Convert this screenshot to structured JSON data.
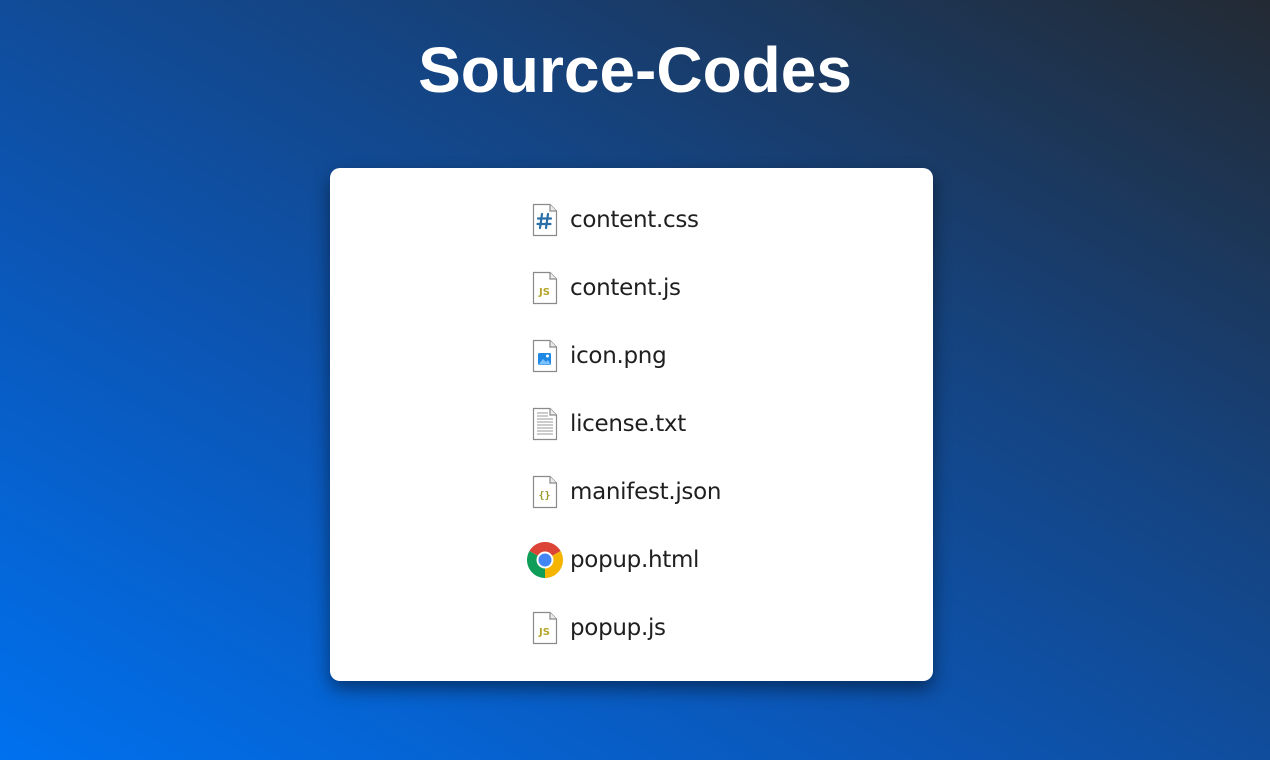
{
  "page": {
    "title": "Source-Codes"
  },
  "files": [
    {
      "name": "content.css",
      "icon": "css-file-icon"
    },
    {
      "name": "content.js",
      "icon": "js-file-icon"
    },
    {
      "name": "icon.png",
      "icon": "image-file-icon"
    },
    {
      "name": "license.txt",
      "icon": "text-file-icon"
    },
    {
      "name": "manifest.json",
      "icon": "json-file-icon"
    },
    {
      "name": "popup.html",
      "icon": "chrome-icon"
    },
    {
      "name": "popup.js",
      "icon": "js-file-icon"
    }
  ],
  "colors": {
    "css_accent": "#2a6fa8",
    "js_accent": "#b7a52a",
    "json_accent": "#9a9a2a",
    "image_accent": "#1e88e5",
    "card_background": "#ffffff",
    "title_color": "#ffffff"
  }
}
